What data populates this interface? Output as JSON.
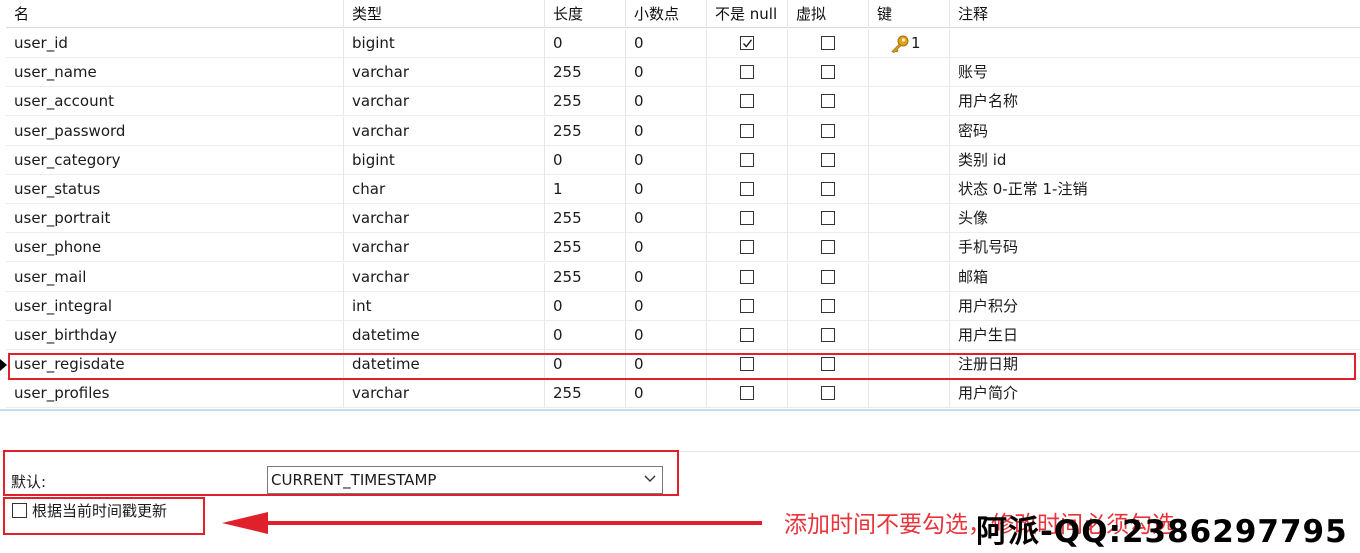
{
  "columns": [
    "名",
    "类型",
    "长度",
    "小数点",
    "不是 null",
    "虚拟",
    "键",
    "注释"
  ],
  "rows": [
    {
      "name": "user_id",
      "type": "bigint",
      "length": "0",
      "decimals": "0",
      "not_null": true,
      "virtual": false,
      "key": "1",
      "comment": ""
    },
    {
      "name": "user_name",
      "type": "varchar",
      "length": "255",
      "decimals": "0",
      "not_null": false,
      "virtual": false,
      "key": "",
      "comment": "账号"
    },
    {
      "name": "user_account",
      "type": "varchar",
      "length": "255",
      "decimals": "0",
      "not_null": false,
      "virtual": false,
      "key": "",
      "comment": "用户名称"
    },
    {
      "name": "user_password",
      "type": "varchar",
      "length": "255",
      "decimals": "0",
      "not_null": false,
      "virtual": false,
      "key": "",
      "comment": "密码"
    },
    {
      "name": "user_category",
      "type": "bigint",
      "length": "0",
      "decimals": "0",
      "not_null": false,
      "virtual": false,
      "key": "",
      "comment": "类别 id"
    },
    {
      "name": "user_status",
      "type": "char",
      "length": "1",
      "decimals": "0",
      "not_null": false,
      "virtual": false,
      "key": "",
      "comment": "状态 0-正常 1-注销"
    },
    {
      "name": "user_portrait",
      "type": "varchar",
      "length": "255",
      "decimals": "0",
      "not_null": false,
      "virtual": false,
      "key": "",
      "comment": "头像"
    },
    {
      "name": "user_phone",
      "type": "varchar",
      "length": "255",
      "decimals": "0",
      "not_null": false,
      "virtual": false,
      "key": "",
      "comment": "手机号码"
    },
    {
      "name": "user_mail",
      "type": "varchar",
      "length": "255",
      "decimals": "0",
      "not_null": false,
      "virtual": false,
      "key": "",
      "comment": "邮箱"
    },
    {
      "name": "user_integral",
      "type": "int",
      "length": "0",
      "decimals": "0",
      "not_null": false,
      "virtual": false,
      "key": "",
      "comment": "用户积分"
    },
    {
      "name": "user_birthday",
      "type": "datetime",
      "length": "0",
      "decimals": "0",
      "not_null": false,
      "virtual": false,
      "key": "",
      "comment": "用户生日"
    },
    {
      "name": "user_regisdate",
      "type": "datetime",
      "length": "0",
      "decimals": "0",
      "not_null": false,
      "virtual": false,
      "key": "",
      "comment": "注册日期",
      "selected": true
    },
    {
      "name": "user_profiles",
      "type": "varchar",
      "length": "255",
      "decimals": "0",
      "not_null": false,
      "virtual": false,
      "key": "",
      "comment": "用户简介"
    }
  ],
  "properties": {
    "default_label": "默认:",
    "default_value": "CURRENT_TIMESTAMP",
    "update_label": "根据当前时间戳更新",
    "update_checked": false
  },
  "annotation": {
    "text": "添加时间不要勾选，修改时间必须勾选",
    "watermark": "阿派-QQ:2386297795"
  },
  "colors": {
    "highlight": "#e0202a",
    "annotation_text": "#e8353b",
    "separator": "#c8dcee",
    "key_icon": "#e0a21c"
  }
}
